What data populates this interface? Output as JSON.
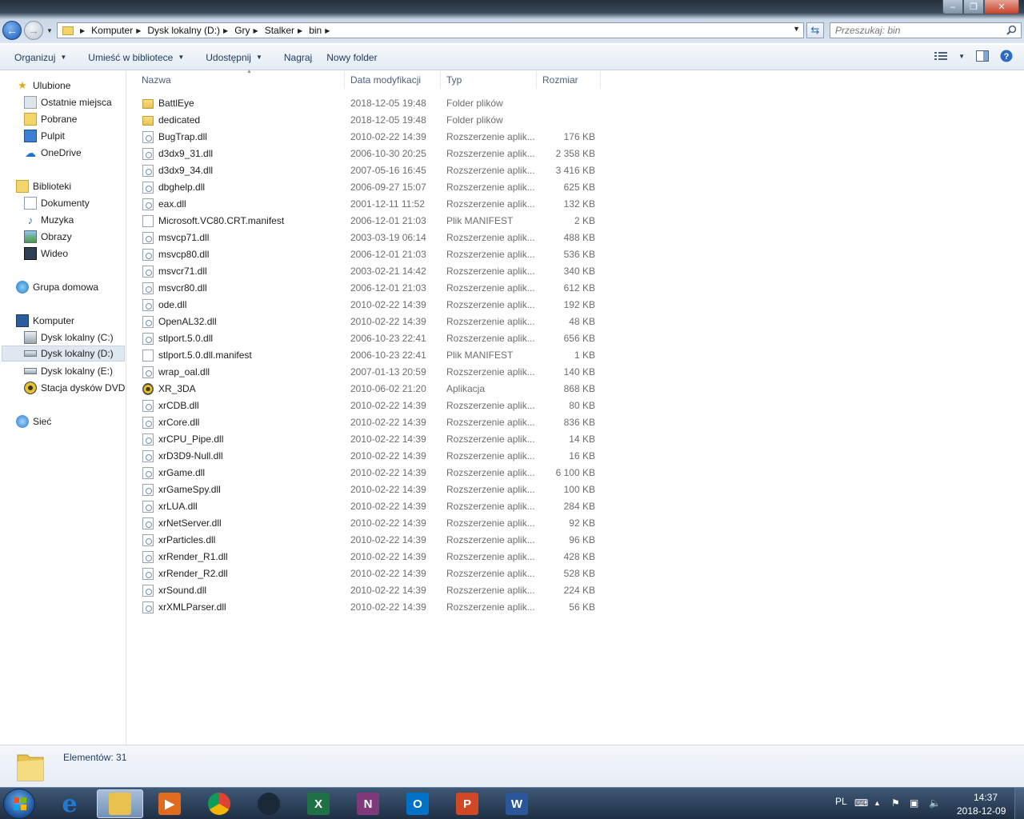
{
  "window": {
    "controls": {
      "minimize": "–",
      "maximize": "❐",
      "close": "✕"
    }
  },
  "address": {
    "breadcrumbs": [
      "Komputer",
      "Dysk lokalny (D:)",
      "Gry",
      "Stalker",
      "bin"
    ]
  },
  "search": {
    "placeholder": "Przeszukaj: bin"
  },
  "toolbar": {
    "organize": "Organizuj",
    "include_library": "Umieść w bibliotece",
    "share": "Udostępnij",
    "burn": "Nagraj",
    "new_folder": "Nowy folder"
  },
  "sidebar": {
    "favorites": {
      "label": "Ulubione",
      "items": [
        "Ostatnie miejsca",
        "Pobrane",
        "Pulpit",
        "OneDrive"
      ]
    },
    "libraries": {
      "label": "Biblioteki",
      "items": [
        "Dokumenty",
        "Muzyka",
        "Obrazy",
        "Wideo"
      ]
    },
    "homegroup": "Grupa domowa",
    "computer": {
      "label": "Komputer",
      "items": [
        "Dysk lokalny (C:)",
        "Dysk lokalny (D:)",
        "Dysk lokalny (E:)",
        "Stacja dysków DVD F"
      ]
    },
    "network": "Sieć",
    "selected": "Dysk lokalny (D:)"
  },
  "columns": {
    "name": "Nazwa",
    "date": "Data modyfikacji",
    "type": "Typ",
    "size": "Rozmiar"
  },
  "files": [
    {
      "name": "BattlEye",
      "date": "2018-12-05 19:48",
      "type": "Folder plików",
      "size": "",
      "icon": "folder-icon"
    },
    {
      "name": "dedicated",
      "date": "2018-12-05 19:48",
      "type": "Folder plików",
      "size": "",
      "icon": "folder-icon"
    },
    {
      "name": "BugTrap.dll",
      "date": "2010-02-22 14:39",
      "type": "Rozszerzenie aplik...",
      "size": "176 KB",
      "icon": "dll-icon"
    },
    {
      "name": "d3dx9_31.dll",
      "date": "2006-10-30 20:25",
      "type": "Rozszerzenie aplik...",
      "size": "2 358 KB",
      "icon": "dll-icon"
    },
    {
      "name": "d3dx9_34.dll",
      "date": "2007-05-16 16:45",
      "type": "Rozszerzenie aplik...",
      "size": "3 416 KB",
      "icon": "dll-icon"
    },
    {
      "name": "dbghelp.dll",
      "date": "2006-09-27 15:07",
      "type": "Rozszerzenie aplik...",
      "size": "625 KB",
      "icon": "dll-icon"
    },
    {
      "name": "eax.dll",
      "date": "2001-12-11 11:52",
      "type": "Rozszerzenie aplik...",
      "size": "132 KB",
      "icon": "dll-icon"
    },
    {
      "name": "Microsoft.VC80.CRT.manifest",
      "date": "2006-12-01 21:03",
      "type": "Plik MANIFEST",
      "size": "2 KB",
      "icon": "file-icon"
    },
    {
      "name": "msvcp71.dll",
      "date": "2003-03-19 06:14",
      "type": "Rozszerzenie aplik...",
      "size": "488 KB",
      "icon": "dll-icon"
    },
    {
      "name": "msvcp80.dll",
      "date": "2006-12-01 21:03",
      "type": "Rozszerzenie aplik...",
      "size": "536 KB",
      "icon": "dll-icon"
    },
    {
      "name": "msvcr71.dll",
      "date": "2003-02-21 14:42",
      "type": "Rozszerzenie aplik...",
      "size": "340 KB",
      "icon": "dll-icon"
    },
    {
      "name": "msvcr80.dll",
      "date": "2006-12-01 21:03",
      "type": "Rozszerzenie aplik...",
      "size": "612 KB",
      "icon": "dll-icon"
    },
    {
      "name": "ode.dll",
      "date": "2010-02-22 14:39",
      "type": "Rozszerzenie aplik...",
      "size": "192 KB",
      "icon": "dll-icon"
    },
    {
      "name": "OpenAL32.dll",
      "date": "2010-02-22 14:39",
      "type": "Rozszerzenie aplik...",
      "size": "48 KB",
      "icon": "dll-icon"
    },
    {
      "name": "stlport.5.0.dll",
      "date": "2006-10-23 22:41",
      "type": "Rozszerzenie aplik...",
      "size": "656 KB",
      "icon": "dll-icon"
    },
    {
      "name": "stlport.5.0.dll.manifest",
      "date": "2006-10-23 22:41",
      "type": "Plik MANIFEST",
      "size": "1 KB",
      "icon": "file-icon"
    },
    {
      "name": "wrap_oal.dll",
      "date": "2007-01-13 20:59",
      "type": "Rozszerzenie aplik...",
      "size": "140 KB",
      "icon": "dll-icon"
    },
    {
      "name": "XR_3DA",
      "date": "2010-06-02 21:20",
      "type": "Aplikacja",
      "size": "868 KB",
      "icon": "exe-icon"
    },
    {
      "name": "xrCDB.dll",
      "date": "2010-02-22 14:39",
      "type": "Rozszerzenie aplik...",
      "size": "80 KB",
      "icon": "dll-icon"
    },
    {
      "name": "xrCore.dll",
      "date": "2010-02-22 14:39",
      "type": "Rozszerzenie aplik...",
      "size": "836 KB",
      "icon": "dll-icon"
    },
    {
      "name": "xrCPU_Pipe.dll",
      "date": "2010-02-22 14:39",
      "type": "Rozszerzenie aplik...",
      "size": "14 KB",
      "icon": "dll-icon"
    },
    {
      "name": "xrD3D9-Null.dll",
      "date": "2010-02-22 14:39",
      "type": "Rozszerzenie aplik...",
      "size": "16 KB",
      "icon": "dll-icon"
    },
    {
      "name": "xrGame.dll",
      "date": "2010-02-22 14:39",
      "type": "Rozszerzenie aplik...",
      "size": "6 100 KB",
      "icon": "dll-icon"
    },
    {
      "name": "xrGameSpy.dll",
      "date": "2010-02-22 14:39",
      "type": "Rozszerzenie aplik...",
      "size": "100 KB",
      "icon": "dll-icon"
    },
    {
      "name": "xrLUA.dll",
      "date": "2010-02-22 14:39",
      "type": "Rozszerzenie aplik...",
      "size": "284 KB",
      "icon": "dll-icon"
    },
    {
      "name": "xrNetServer.dll",
      "date": "2010-02-22 14:39",
      "type": "Rozszerzenie aplik...",
      "size": "92 KB",
      "icon": "dll-icon"
    },
    {
      "name": "xrParticles.dll",
      "date": "2010-02-22 14:39",
      "type": "Rozszerzenie aplik...",
      "size": "96 KB",
      "icon": "dll-icon"
    },
    {
      "name": "xrRender_R1.dll",
      "date": "2010-02-22 14:39",
      "type": "Rozszerzenie aplik...",
      "size": "428 KB",
      "icon": "dll-icon"
    },
    {
      "name": "xrRender_R2.dll",
      "date": "2010-02-22 14:39",
      "type": "Rozszerzenie aplik...",
      "size": "528 KB",
      "icon": "dll-icon"
    },
    {
      "name": "xrSound.dll",
      "date": "2010-02-22 14:39",
      "type": "Rozszerzenie aplik...",
      "size": "224 KB",
      "icon": "dll-icon"
    },
    {
      "name": "xrXMLParser.dll",
      "date": "2010-02-22 14:39",
      "type": "Rozszerzenie aplik...",
      "size": "56 KB",
      "icon": "dll-icon"
    }
  ],
  "details": {
    "count": "Elementów: 31"
  },
  "taskbar": {
    "apps": [
      {
        "name": "internet-explorer",
        "glyph": "e",
        "color": "#1f7ad6"
      },
      {
        "name": "windows-explorer",
        "glyph": "",
        "color": "#e8c24f"
      },
      {
        "name": "media-player",
        "glyph": "▶",
        "color": "#e06a1e"
      },
      {
        "name": "chrome",
        "glyph": "",
        "color": "#db4437"
      },
      {
        "name": "steam",
        "glyph": "",
        "color": "#1b2838"
      },
      {
        "name": "excel",
        "glyph": "X",
        "color": "#1e7145"
      },
      {
        "name": "onenote",
        "glyph": "N",
        "color": "#80397b"
      },
      {
        "name": "outlook",
        "glyph": "O",
        "color": "#0072c6"
      },
      {
        "name": "powerpoint",
        "glyph": "P",
        "color": "#d24726"
      },
      {
        "name": "word",
        "glyph": "W",
        "color": "#2b579a"
      }
    ],
    "active_app": "windows-explorer",
    "tray": {
      "language": "PL",
      "time": "14:37",
      "date": "2018-12-09"
    }
  }
}
